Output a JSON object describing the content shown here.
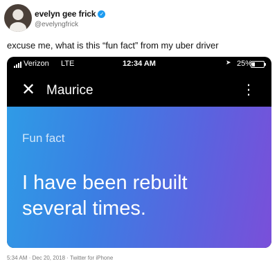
{
  "tweet": {
    "display_name": "evelyn gee frick",
    "handle": "@evelyngfrick",
    "text": "excuse me, what is this “fun fact” from my uber driver",
    "timestamp": "5:34 AM · Dec 20, 2018 · Twitter for iPhone",
    "verified_icon": "verified-badge-icon"
  },
  "screenshot": {
    "status_bar": {
      "carrier": "Verizon",
      "network": "LTE",
      "time": "12:34 AM",
      "battery": "25%",
      "icons": [
        "signal-icon",
        "location-arrow-icon",
        "battery-icon"
      ]
    },
    "app_bar": {
      "title": "Maurice",
      "close_glyph": "✕",
      "more_glyph": "⋮"
    },
    "content": {
      "label": "Fun fact",
      "message": "I have been rebuilt several times."
    },
    "colors": {
      "gradient_start": "#2f9be6",
      "gradient_end": "#7a4fd9",
      "bar_background": "#000000"
    }
  }
}
